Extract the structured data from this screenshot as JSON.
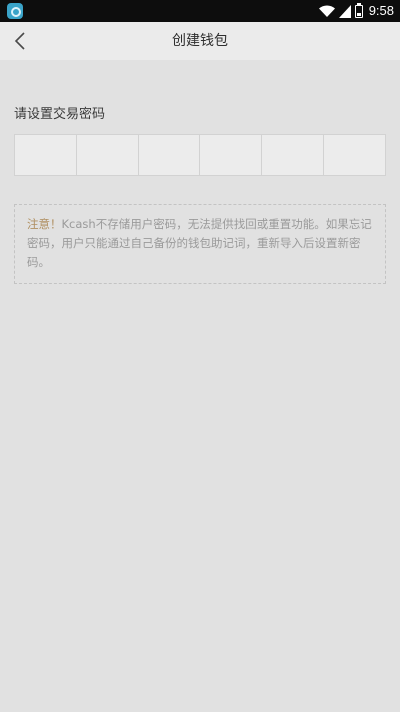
{
  "status_bar": {
    "time": "9:58",
    "icons": [
      "app-icon",
      "wifi-icon",
      "signal-icon",
      "battery-icon"
    ]
  },
  "nav": {
    "back_icon": "chevron-left-icon",
    "title": "创建钱包"
  },
  "password": {
    "label": "请设置交易密码",
    "digit_count": 6
  },
  "notice": {
    "title": "注意！",
    "body": "Kcash不存储用户密码，无法提供找回或重置功能。如果忘记密码，用户只能通过自己备份的钱包助记词，重新导入后设置新密码。"
  },
  "colors": {
    "background": "#e1e1e1",
    "nav_background": "#ebebeb",
    "status_bar": "#0d0d0d",
    "notice_title": "#b09062",
    "notice_text": "#9a9a9a"
  }
}
